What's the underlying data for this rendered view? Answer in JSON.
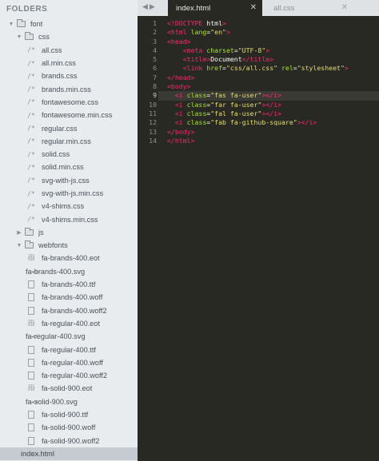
{
  "sidebar": {
    "title": "FOLDERS",
    "tree": [
      {
        "kind": "folder",
        "label": "font",
        "depth": 0,
        "open": true
      },
      {
        "kind": "folder",
        "label": "css",
        "depth": 1,
        "open": true
      },
      {
        "kind": "css",
        "label": "all.css",
        "depth": 2
      },
      {
        "kind": "css",
        "label": "all.min.css",
        "depth": 2
      },
      {
        "kind": "css",
        "label": "brands.css",
        "depth": 2
      },
      {
        "kind": "css",
        "label": "brands.min.css",
        "depth": 2
      },
      {
        "kind": "css",
        "label": "fontawesome.css",
        "depth": 2
      },
      {
        "kind": "css",
        "label": "fontawesome.min.css",
        "depth": 2
      },
      {
        "kind": "css",
        "label": "regular.css",
        "depth": 2
      },
      {
        "kind": "css",
        "label": "regular.min.css",
        "depth": 2
      },
      {
        "kind": "css",
        "label": "solid.css",
        "depth": 2
      },
      {
        "kind": "css",
        "label": "solid.min.css",
        "depth": 2
      },
      {
        "kind": "css",
        "label": "svg-with-js.css",
        "depth": 2
      },
      {
        "kind": "css",
        "label": "svg-with-js.min.css",
        "depth": 2
      },
      {
        "kind": "css",
        "label": "v4-shims.css",
        "depth": 2
      },
      {
        "kind": "css",
        "label": "v4-shims.min.css",
        "depth": 2
      },
      {
        "kind": "folder",
        "label": "js",
        "depth": 1,
        "open": false
      },
      {
        "kind": "folder",
        "label": "webfonts",
        "depth": 1,
        "open": true
      },
      {
        "kind": "bin",
        "label": "fa-brands-400.eot",
        "depth": 2
      },
      {
        "kind": "code",
        "label": "fa-brands-400.svg",
        "depth": 2
      },
      {
        "kind": "doc",
        "label": "fa-brands-400.ttf",
        "depth": 2
      },
      {
        "kind": "doc",
        "label": "fa-brands-400.woff",
        "depth": 2
      },
      {
        "kind": "doc",
        "label": "fa-brands-400.woff2",
        "depth": 2
      },
      {
        "kind": "bin",
        "label": "fa-regular-400.eot",
        "depth": 2
      },
      {
        "kind": "code",
        "label": "fa-regular-400.svg",
        "depth": 2
      },
      {
        "kind": "doc",
        "label": "fa-regular-400.ttf",
        "depth": 2
      },
      {
        "kind": "doc",
        "label": "fa-regular-400.woff",
        "depth": 2
      },
      {
        "kind": "doc",
        "label": "fa-regular-400.woff2",
        "depth": 2
      },
      {
        "kind": "bin",
        "label": "fa-solid-900.eot",
        "depth": 2
      },
      {
        "kind": "code",
        "label": "fa-solid-900.svg",
        "depth": 2
      },
      {
        "kind": "doc",
        "label": "fa-solid-900.ttf",
        "depth": 2
      },
      {
        "kind": "doc",
        "label": "fa-solid-900.woff",
        "depth": 2
      },
      {
        "kind": "doc",
        "label": "fa-solid-900.woff2",
        "depth": 2
      },
      {
        "kind": "code",
        "label": "index.html",
        "depth": 0,
        "selected": true
      }
    ]
  },
  "tabs": {
    "nav_glyphs": "◀▶",
    "active": {
      "label": "index.html",
      "close": "✕"
    },
    "inactive": {
      "label": "all.css",
      "close": "✕"
    }
  },
  "editor": {
    "current_line": 9,
    "line_numbers": [
      "1",
      "2",
      "3",
      "4",
      "5",
      "6",
      "7",
      "8",
      "9",
      "10",
      "11",
      "12",
      "13",
      "14"
    ],
    "lines": [
      {
        "indent": "",
        "tokens": [
          [
            "t-tag",
            "<!DOCTYPE"
          ],
          [
            "t-txt",
            " html"
          ],
          [
            "t-tag",
            ">"
          ]
        ]
      },
      {
        "indent": "",
        "tokens": [
          [
            "t-tag",
            "<html"
          ],
          [
            "t-attr",
            " lang"
          ],
          [
            "t-pun",
            "="
          ],
          [
            "t-str",
            "\"en\""
          ],
          [
            "t-tag",
            ">"
          ]
        ]
      },
      {
        "indent": "",
        "tokens": [
          [
            "t-tag",
            "<head>"
          ]
        ]
      },
      {
        "indent": "    ",
        "tokens": [
          [
            "t-tag",
            "<meta"
          ],
          [
            "t-attr",
            " charset"
          ],
          [
            "t-pun",
            "="
          ],
          [
            "t-str",
            "\"UTF-8\""
          ],
          [
            "t-tag",
            ">"
          ]
        ]
      },
      {
        "indent": "    ",
        "tokens": [
          [
            "t-tag",
            "<title>"
          ],
          [
            "t-txt",
            "Document"
          ],
          [
            "t-tag",
            "</title>"
          ]
        ]
      },
      {
        "indent": "    ",
        "tokens": [
          [
            "t-tag",
            "<link"
          ],
          [
            "t-attr",
            " href"
          ],
          [
            "t-pun",
            "="
          ],
          [
            "t-str",
            "\"css/all.css\""
          ],
          [
            "t-attr",
            " rel"
          ],
          [
            "t-pun",
            "="
          ],
          [
            "t-str",
            "\"stylesheet\""
          ],
          [
            "t-tag",
            ">"
          ]
        ]
      },
      {
        "indent": "",
        "tokens": [
          [
            "t-tag",
            "</head>"
          ]
        ]
      },
      {
        "indent": "",
        "tokens": [
          [
            "t-tag",
            "<body>"
          ]
        ]
      },
      {
        "indent": "  ",
        "tokens": [
          [
            "t-tag",
            "<i"
          ],
          [
            "t-attr",
            " class"
          ],
          [
            "t-pun",
            "="
          ],
          [
            "t-str",
            "\"fas fa-user\""
          ],
          [
            "t-tag",
            "></i>"
          ]
        ]
      },
      {
        "indent": "  ",
        "tokens": [
          [
            "t-tag",
            "<i"
          ],
          [
            "t-attr",
            " class"
          ],
          [
            "t-pun",
            "="
          ],
          [
            "t-str",
            "\"far fa-user\""
          ],
          [
            "t-tag",
            "></i>"
          ]
        ]
      },
      {
        "indent": "  ",
        "tokens": [
          [
            "t-tag",
            "<i"
          ],
          [
            "t-attr",
            " class"
          ],
          [
            "t-pun",
            "="
          ],
          [
            "t-str",
            "\"fal fa-user\""
          ],
          [
            "t-tag",
            "></i>"
          ]
        ]
      },
      {
        "indent": "  ",
        "tokens": [
          [
            "t-tag",
            "<i"
          ],
          [
            "t-attr",
            " class"
          ],
          [
            "t-pun",
            "="
          ],
          [
            "t-str",
            "\"fab fa-github-square\""
          ],
          [
            "t-tag",
            "></i>"
          ]
        ]
      },
      {
        "indent": "",
        "tokens": [
          [
            "t-tag",
            "</body>"
          ]
        ]
      },
      {
        "indent": "",
        "tokens": [
          [
            "t-tag",
            "</html>"
          ]
        ]
      }
    ]
  }
}
